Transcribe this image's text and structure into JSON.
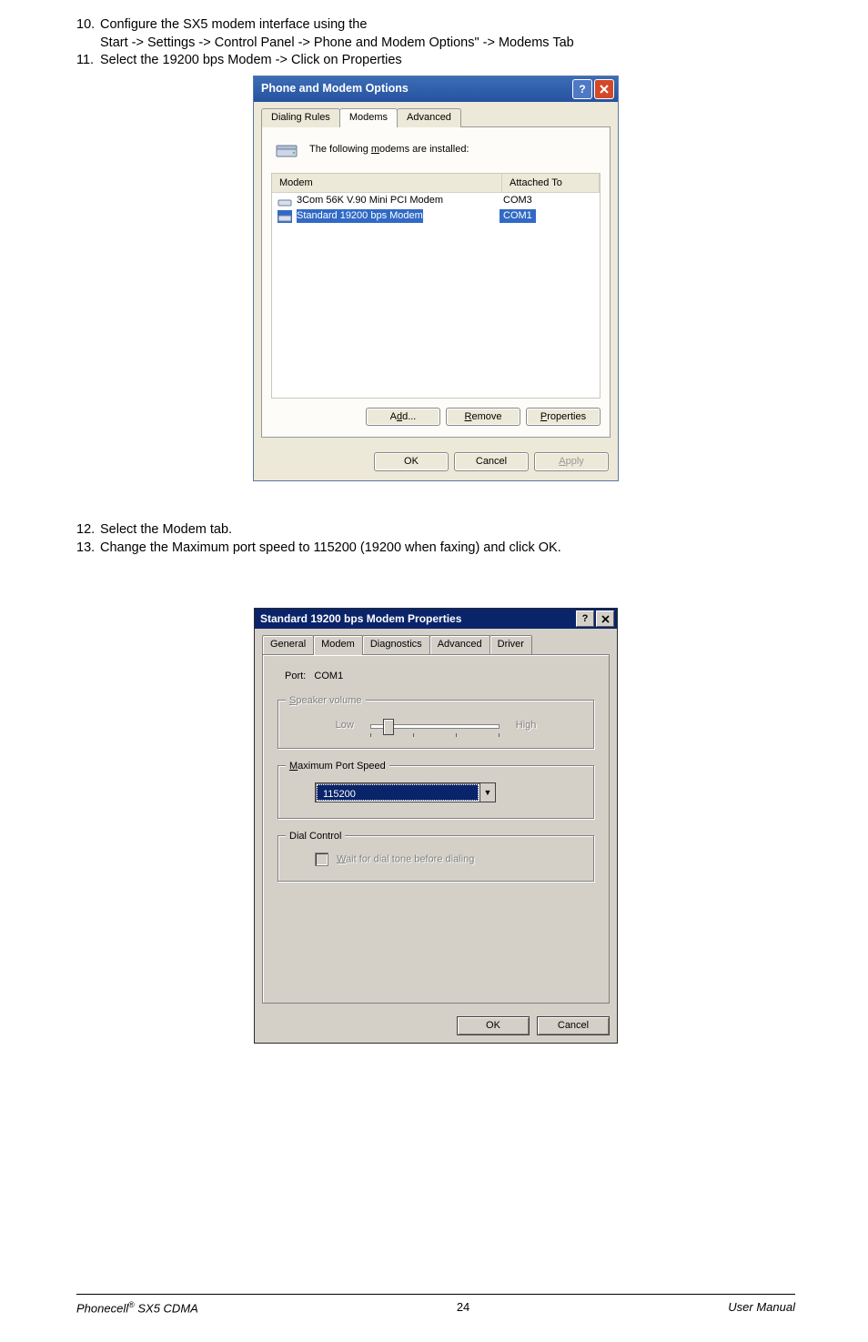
{
  "instructions": {
    "i10_num": "10.",
    "i10_a": "Configure the SX5 modem interface using the",
    "i10_b": "Start -> Settings -> Control Panel -> Phone and Modem Options\" -> Modems Tab",
    "i11_num": "11.",
    "i11": "Select the 19200 bps Modem -> Click on Properties",
    "i12_num": "12.",
    "i12": "Select the Modem tab.",
    "i13_num": "13.",
    "i13": "Change the Maximum port speed to 115200 (19200 when faxing) and click OK."
  },
  "dlg1": {
    "title": "Phone and Modem Options",
    "tabs": {
      "t1": "Dialing Rules",
      "t2": "Modems",
      "t3": "Advanced"
    },
    "intro_pre": "The following ",
    "intro_und": "m",
    "intro_post": "odems are installed:",
    "col1": "Modem",
    "col2": "Attached To",
    "rows": [
      {
        "name": "3Com 56K V.90 Mini PCI Modem",
        "port": "COM3",
        "selected": false
      },
      {
        "name": "Standard 19200 bps Modem",
        "port": "COM1",
        "selected": true
      }
    ],
    "btnAdd_pre": "A",
    "btnAdd_und": "d",
    "btnAdd_post": "d...",
    "btnRemove_und": "R",
    "btnRemove_post": "emove",
    "btnProps_und": "P",
    "btnProps_post": "roperties",
    "btnOK": "OK",
    "btnCancel": "Cancel",
    "btnApply_und": "A",
    "btnApply_post": "pply"
  },
  "dlg2": {
    "title": "Standard 19200 bps Modem Properties",
    "tabs": {
      "t1": "General",
      "t2": "Modem",
      "t3": "Diagnostics",
      "t4": "Advanced",
      "t5": "Driver"
    },
    "port_label": "Port:",
    "port_value": "COM1",
    "grp_speaker_und": "S",
    "grp_speaker_post": "peaker volume",
    "low": "Low",
    "high": "High",
    "grp_speed_und": "M",
    "grp_speed_post": "aximum Port Speed",
    "speed_value": "115200",
    "grp_dial": "Dial Control",
    "chk_und": "W",
    "chk_post": "ait for dial tone before dialing",
    "btnOK": "OK",
    "btnCancel": "Cancel"
  },
  "footer": {
    "left_a": "Phonecell",
    "left_sup": "®",
    "left_b": " SX5 CDMA",
    "center": "24",
    "right": "User Manual"
  }
}
